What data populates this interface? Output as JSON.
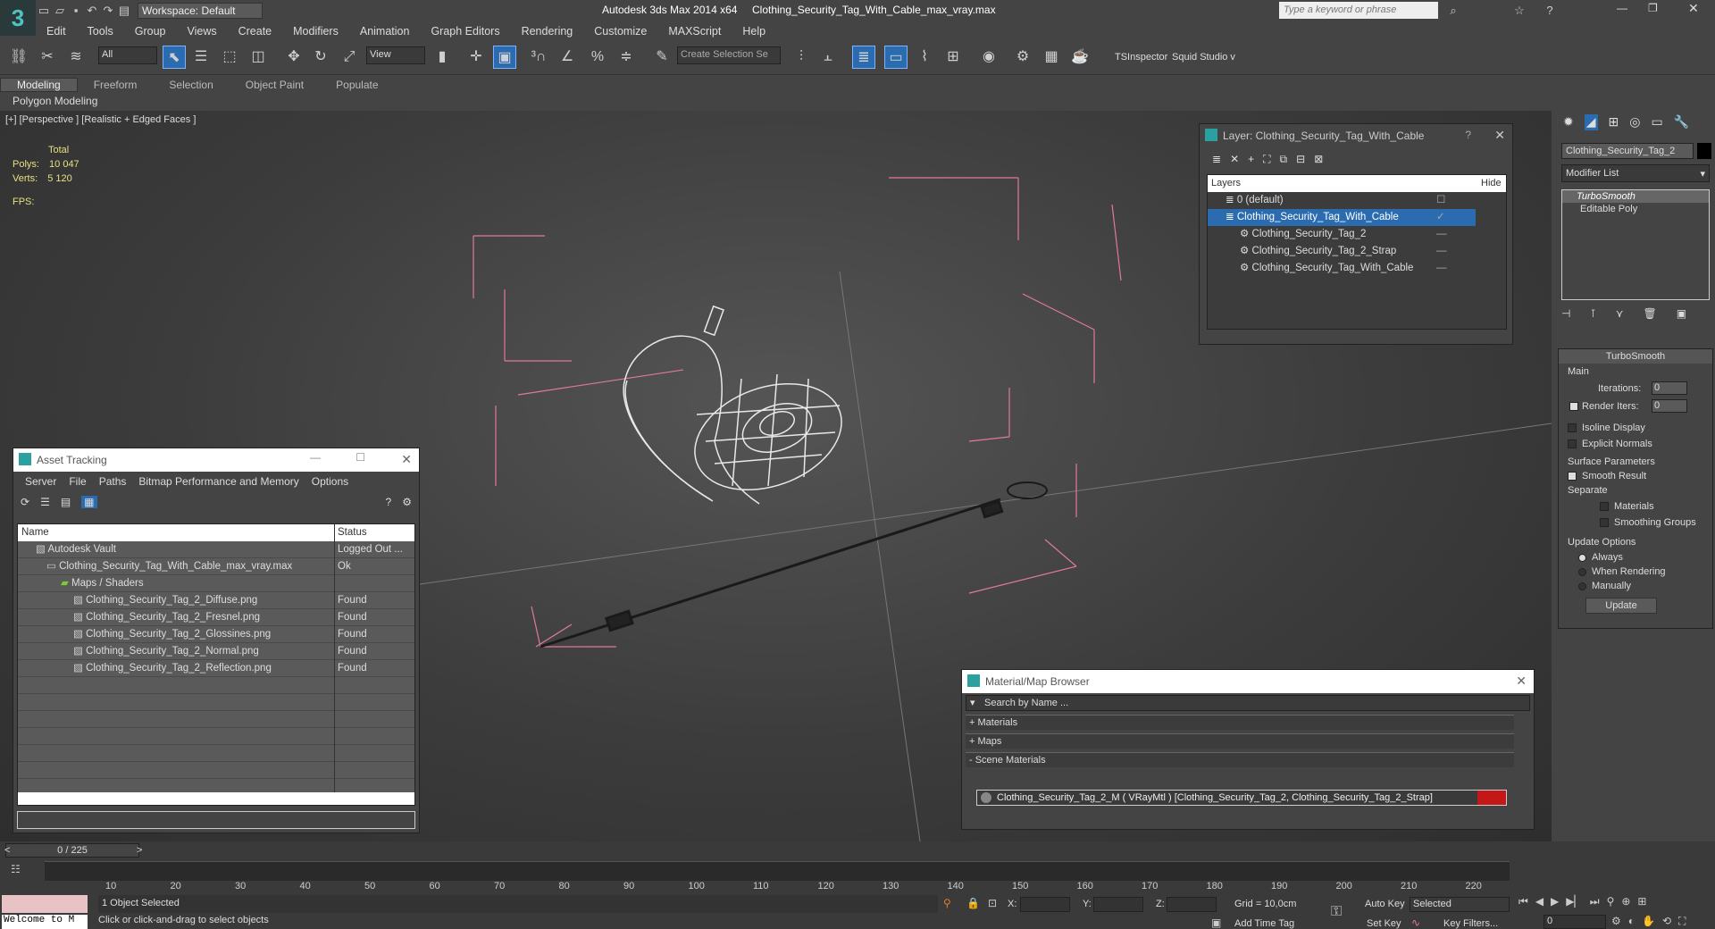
{
  "app": {
    "title": "Autodesk 3ds Max  2014 x64",
    "file": "Clothing_Security_Tag_With_Cable_max_vray.max",
    "workspace": "Workspace: Default",
    "search_placeholder": "Type a keyword or phrase"
  },
  "menu": [
    "Edit",
    "Tools",
    "Group",
    "Views",
    "Create",
    "Modifiers",
    "Animation",
    "Graph Editors",
    "Rendering",
    "Customize",
    "MAXScript",
    "Help"
  ],
  "toolbar": {
    "filter": "All",
    "refcoord": "View",
    "selection_set": "Create Selection Se",
    "ts": "TSInspector",
    "squid": "Squid Studio v"
  },
  "ribbon": {
    "tabs": [
      "Modeling",
      "Freeform",
      "Selection",
      "Object Paint",
      "Populate"
    ],
    "sub": "Polygon Modeling"
  },
  "viewport": {
    "label": "[+] [Perspective ] [Realistic + Edged Faces ]",
    "total": "Total",
    "polys_label": "Polys:",
    "polys": "10 047",
    "verts_label": "Verts:",
    "verts": "5 120",
    "fps": "FPS:"
  },
  "layer_panel": {
    "title": "Layer: Clothing_Security_Tag_With_Cable",
    "col_layers": "Layers",
    "col_hide": "Hide",
    "rows": [
      "0 (default)",
      "Clothing_Security_Tag_With_Cable",
      "Clothing_Security_Tag_2",
      "Clothing_Security_Tag_2_Strap",
      "Clothing_Security_Tag_With_Cable"
    ]
  },
  "asset_panel": {
    "title": "Asset Tracking",
    "menu": [
      "Server",
      "File",
      "Paths",
      "Bitmap Performance and Memory",
      "Options"
    ],
    "col_name": "Name",
    "col_status": "Status",
    "rows": [
      {
        "name": "Autodesk Vault",
        "status": "Logged Out ..."
      },
      {
        "name": "Clothing_Security_Tag_With_Cable_max_vray.max",
        "status": "Ok"
      },
      {
        "name": "Maps / Shaders",
        "status": ""
      },
      {
        "name": "Clothing_Security_Tag_2_Diffuse.png",
        "status": "Found"
      },
      {
        "name": "Clothing_Security_Tag_2_Fresnel.png",
        "status": "Found"
      },
      {
        "name": "Clothing_Security_Tag_2_Glossines.png",
        "status": "Found"
      },
      {
        "name": "Clothing_Security_Tag_2_Normal.png",
        "status": "Found"
      },
      {
        "name": "Clothing_Security_Tag_2_Reflection.png",
        "status": "Found"
      }
    ]
  },
  "material_panel": {
    "title": "Material/Map Browser",
    "search_placeholder": "Search by Name ...",
    "sections": [
      "+ Materials",
      "+ Maps",
      "- Scene Materials"
    ],
    "item": "Clothing_Security_Tag_2_M  ( VRayMtl ) [Clothing_Security_Tag_2, Clothing_Security_Tag_2_Strap]"
  },
  "command_panel": {
    "object_name": "Clothing_Security_Tag_2",
    "modifier_list": "Modifier List",
    "stack": [
      "TurboSmooth",
      "Editable Poly"
    ],
    "rollout": "TurboSmooth",
    "main": "Main",
    "iterations_label": "Iterations:",
    "iterations": "0",
    "render_iters_label": "Render Iters:",
    "render_iters": "0",
    "isoline": "Isoline Display",
    "explicit": "Explicit Normals",
    "surface": "Surface Parameters",
    "smooth": "Smooth Result",
    "separate": "Separate",
    "materials": "Materials",
    "smoothing": "Smoothing Groups",
    "update_options": "Update Options",
    "always": "Always",
    "when_rendering": "When Rendering",
    "manually": "Manually",
    "update_btn": "Update"
  },
  "timeline": {
    "frame": "0 / 225",
    "ticks": [
      "10",
      "20",
      "30",
      "40",
      "50",
      "60",
      "70",
      "80",
      "90",
      "100",
      "110",
      "120",
      "130",
      "140",
      "150",
      "160",
      "170",
      "180",
      "190",
      "200",
      "210",
      "220"
    ],
    "welcome": "Welcome to M",
    "selected": "1 Object Selected",
    "hint": "Click or click-and-drag to select objects",
    "x": "X:",
    "y": "Y:",
    "z": "Z:",
    "grid": "Grid = 10,0cm",
    "add_time_tag": "Add Time Tag",
    "auto_key": "Auto Key",
    "selected_dd": "Selected",
    "set_key": "Set Key",
    "key_filters": "Key Filters...",
    "frame_value": "0"
  }
}
